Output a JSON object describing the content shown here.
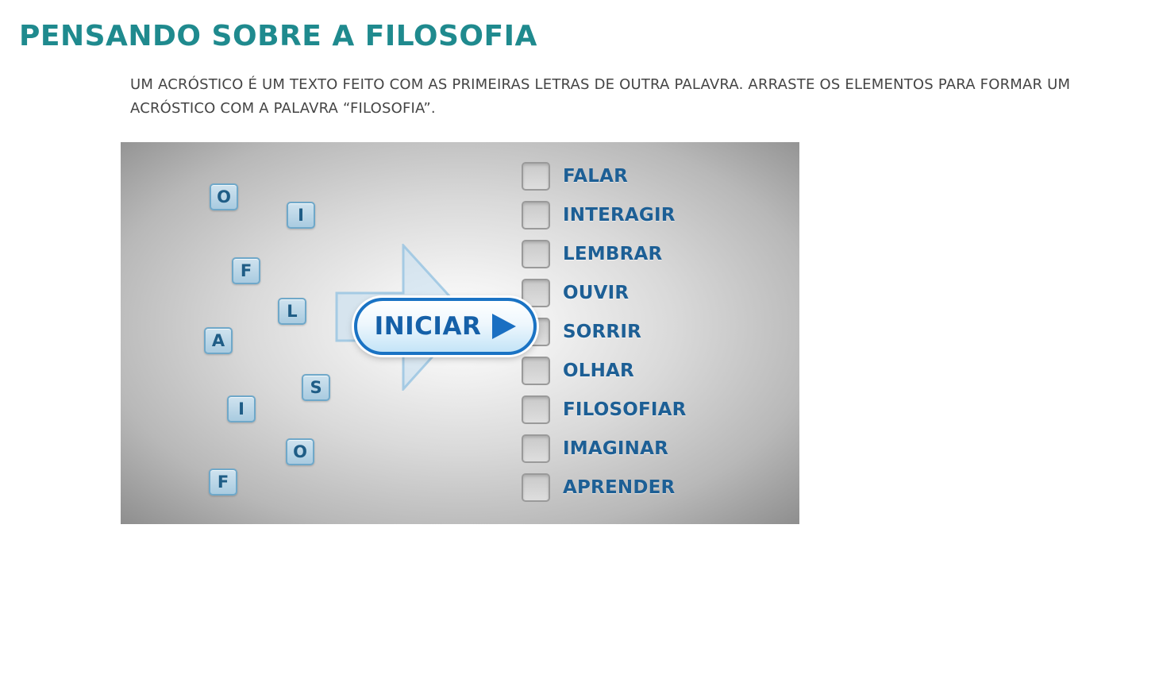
{
  "header": {
    "title": "PENSANDO SOBRE A FILOSOFIA",
    "instructions": "UM ACRÓSTICO É UM TEXTO FEITO COM AS PRIMEIRAS LETRAS DE OUTRA PALAVRA. ARRASTE OS ELEMENTOS PARA FORMAR UM ACRÓSTICO COM A PALAVRA “FILOSOFIA”."
  },
  "colors": {
    "title": "#1f8a8e",
    "instructions": "#444444"
  },
  "activity": {
    "letters": [
      "O",
      "I",
      "F",
      "L",
      "A",
      "S",
      "I",
      "O",
      "F"
    ],
    "words": [
      "FALAR",
      "INTERAGIR",
      "LEMBRAR",
      "OUVIR",
      "SORRIR",
      "OLHAR",
      "FILOSOFIAR",
      "IMAGINAR",
      "APRENDER"
    ],
    "start_button": {
      "label": "INICIAR"
    }
  }
}
